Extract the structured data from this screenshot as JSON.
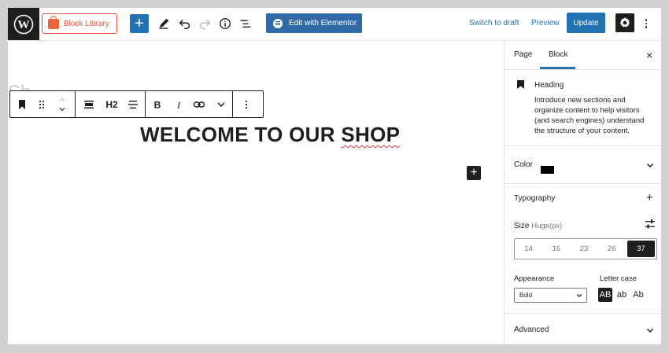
{
  "topbar": {
    "block_library_label": "Block Library",
    "add_label": "+",
    "elementor_label": "Edit with Elementor",
    "switch_to_draft_label": "Switch to draft",
    "preview_label": "Preview",
    "update_label": "Update"
  },
  "editor": {
    "ghost_title": "Sh",
    "heading_level": "H2",
    "heading_text_main": "WELCOME TO OUR ",
    "heading_text_misspelled": "SHOP",
    "inserter_label": "+"
  },
  "sidebar": {
    "tabs": [
      "Page",
      "Block"
    ],
    "active_tab": "Block",
    "close_label": "×",
    "block_card": {
      "title": "Heading",
      "description": "Introduce new sections and organize content to help visitors (and search engines) understand the structure of your content."
    },
    "color": {
      "label": "Color",
      "value": "#000000"
    },
    "typography": {
      "label": "Typography",
      "plus": "+",
      "size_label": "Size",
      "size_unit_note": "Huge(px)",
      "sizes": [
        "14",
        "16",
        "23",
        "26",
        "37"
      ],
      "selected_size": "37",
      "appearance_label": "Appearance",
      "appearance_value": "Bold",
      "letter_case_label": "Letter case",
      "letter_case_options": [
        "AB",
        "ab",
        "Ab"
      ],
      "letter_case_selected": "AB"
    },
    "advanced": {
      "label": "Advanced"
    }
  },
  "colors": {
    "accent": "#2271b1",
    "elementor": "#2f6aa6",
    "block_library": "#e8503a",
    "dark": "#1e1e1e"
  }
}
